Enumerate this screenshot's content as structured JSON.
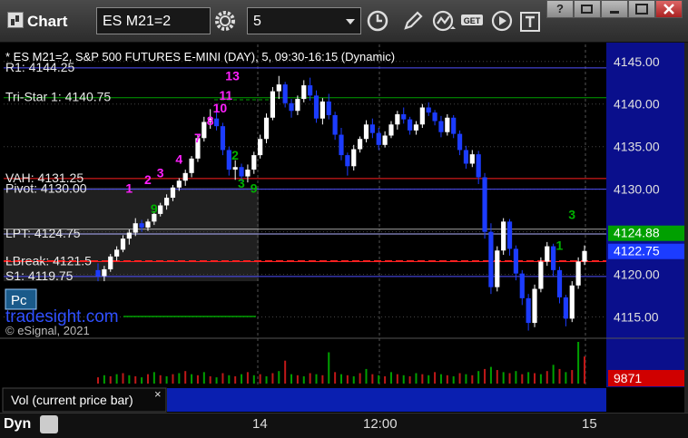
{
  "toolbar": {
    "app_title": "Chart",
    "symbol": "ES M21=2",
    "interval": "5",
    "get_label": "GET"
  },
  "window_buttons": [
    "?",
    "",
    "",
    ""
  ],
  "footer": {
    "dyn_label": "Dyn",
    "x_ticks": [
      "14",
      "12:00",
      "15"
    ]
  },
  "chart_data": {
    "type": "candlestick",
    "title": "* ES M21=2, S&P 500 FUTURES E-MINI (DAY), 5, 09:30-16:15 (Dynamic)",
    "ylim": [
      4112.5,
      4147.0
    ],
    "y_ticks": [
      "4145.00",
      "4140.00",
      "4135.00",
      "4130.00",
      "4125.00",
      "4120.00",
      "4115.00"
    ],
    "price_badges": [
      {
        "label": "4124.88",
        "value": 4124.88,
        "color": "#00a000"
      },
      {
        "label": "4122.75",
        "value": 4122.75,
        "color": "#1c3cff"
      }
    ],
    "levels": [
      {
        "label": "R1: 4144.25",
        "value": 4144.25,
        "color": "#5050ff"
      },
      {
        "label": "Tri-Star 1: 4140.75",
        "value": 4140.75,
        "color": "#00a000"
      },
      {
        "label": "VAH: 4131.25",
        "value": 4131.25,
        "color": "#ff2020"
      },
      {
        "label": "Pivot: 4130.00",
        "value": 4130.0,
        "color": "#5050ff"
      },
      {
        "label": "LPT: 4124.75",
        "value": 4124.75,
        "color": "#b0b0ff"
      },
      {
        "label": "LBreak: 4121.5",
        "value": 4121.5,
        "color": "#ff2020"
      },
      {
        "label": "S1: 4119.75",
        "value": 4119.75,
        "color": "#5050ff"
      }
    ],
    "extra_lines": [
      4140.5,
      4131.4,
      4121.6,
      4120.7,
      4125.3
    ],
    "candles": [
      [
        4120.5,
        4121.3,
        4119.2,
        4119.8
      ],
      [
        4119.8,
        4121.0,
        4119.2,
        4120.6
      ],
      [
        4120.6,
        4122.4,
        4120.3,
        4122.1
      ],
      [
        4122.1,
        4123.3,
        4121.6,
        4122.9
      ],
      [
        4122.9,
        4124.6,
        4122.6,
        4124.2
      ],
      [
        4124.2,
        4125.3,
        4123.5,
        4124.9
      ],
      [
        4124.9,
        4126.6,
        4124.5,
        4126.0
      ],
      [
        4126.0,
        4126.4,
        4125.0,
        4125.5
      ],
      [
        4125.5,
        4126.5,
        4125.1,
        4126.2
      ],
      [
        4126.2,
        4127.4,
        4125.8,
        4127.1
      ],
      [
        4127.1,
        4128.4,
        4126.8,
        4128.1
      ],
      [
        4128.1,
        4129.4,
        4127.6,
        4129.0
      ],
      [
        4129.0,
        4130.5,
        4128.6,
        4130.2
      ],
      [
        4130.2,
        4131.3,
        4129.8,
        4131.0
      ],
      [
        4131.0,
        4132.3,
        4130.4,
        4131.9
      ],
      [
        4131.9,
        4133.9,
        4131.4,
        4133.6
      ],
      [
        4133.6,
        4136.5,
        4133.2,
        4136.0
      ],
      [
        4136.0,
        4138.5,
        4135.6,
        4137.9
      ],
      [
        4137.9,
        4139.4,
        4137.1,
        4138.3
      ],
      [
        4138.3,
        4139.1,
        4136.9,
        4137.4
      ],
      [
        4137.4,
        4137.8,
        4134.0,
        4134.6
      ],
      [
        4134.6,
        4135.0,
        4131.6,
        4132.3
      ],
      [
        4132.3,
        4133.4,
        4131.1,
        4132.6
      ],
      [
        4132.6,
        4133.0,
        4130.9,
        4131.5
      ],
      [
        4131.5,
        4132.9,
        4130.8,
        4132.3
      ],
      [
        4132.3,
        4134.4,
        4131.8,
        4134.0
      ],
      [
        4134.0,
        4136.4,
        4133.6,
        4135.9
      ],
      [
        4135.9,
        4138.9,
        4135.4,
        4138.4
      ],
      [
        4138.4,
        4142.0,
        4138.1,
        4141.5
      ],
      [
        4141.5,
        4143.3,
        4140.6,
        4142.3
      ],
      [
        4142.3,
        4142.6,
        4139.6,
        4140.1
      ],
      [
        4140.1,
        4140.6,
        4138.4,
        4139.2
      ],
      [
        4139.2,
        4141.0,
        4138.7,
        4140.6
      ],
      [
        4140.6,
        4142.8,
        4140.2,
        4142.2
      ],
      [
        4142.2,
        4143.1,
        4140.4,
        4141.0
      ],
      [
        4141.0,
        4141.6,
        4137.8,
        4138.3
      ],
      [
        4138.3,
        4140.7,
        4137.6,
        4140.3
      ],
      [
        4140.3,
        4141.2,
        4138.2,
        4138.7
      ],
      [
        4138.7,
        4139.1,
        4135.8,
        4136.4
      ],
      [
        4136.4,
        4137.2,
        4133.4,
        4134.0
      ],
      [
        4134.0,
        4134.3,
        4131.6,
        4132.7
      ],
      [
        4132.7,
        4135.2,
        4132.2,
        4134.7
      ],
      [
        4134.7,
        4136.2,
        4134.3,
        4135.9
      ],
      [
        4135.9,
        4138.1,
        4135.5,
        4137.6
      ],
      [
        4137.6,
        4138.3,
        4136.0,
        4136.6
      ],
      [
        4136.6,
        4137.2,
        4134.6,
        4135.2
      ],
      [
        4135.2,
        4136.8,
        4134.9,
        4136.3
      ],
      [
        4136.3,
        4138.0,
        4136.0,
        4137.6
      ],
      [
        4137.6,
        4139.2,
        4137.0,
        4138.8
      ],
      [
        4138.8,
        4139.6,
        4137.7,
        4138.2
      ],
      [
        4138.2,
        4138.5,
        4136.4,
        4136.9
      ],
      [
        4136.9,
        4138.0,
        4136.4,
        4137.6
      ],
      [
        4137.6,
        4140.0,
        4137.2,
        4139.6
      ],
      [
        4139.6,
        4140.2,
        4138.6,
        4139.0
      ],
      [
        4139.0,
        4139.3,
        4137.5,
        4138.0
      ],
      [
        4138.0,
        4138.6,
        4136.1,
        4136.7
      ],
      [
        4136.7,
        4138.8,
        4136.3,
        4138.4
      ],
      [
        4138.4,
        4138.7,
        4136.0,
        4136.5
      ],
      [
        4136.5,
        4136.9,
        4134.0,
        4134.6
      ],
      [
        4134.6,
        4135.1,
        4132.4,
        4133.0
      ],
      [
        4133.0,
        4134.6,
        4132.6,
        4134.1
      ],
      [
        4134.1,
        4134.5,
        4130.6,
        4131.4
      ],
      [
        4131.4,
        4131.9,
        4124.2,
        4125.0
      ],
      [
        4125.0,
        4126.0,
        4117.7,
        4118.5
      ],
      [
        4118.5,
        4123.3,
        4118.0,
        4122.8
      ],
      [
        4122.8,
        4126.6,
        4122.3,
        4126.2
      ],
      [
        4126.2,
        4126.5,
        4122.2,
        4123.0
      ],
      [
        4123.0,
        4123.4,
        4119.3,
        4120.1
      ],
      [
        4120.1,
        4120.5,
        4116.4,
        4117.2
      ],
      [
        4117.2,
        4117.7,
        4113.4,
        4114.3
      ],
      [
        4114.3,
        4118.8,
        4113.8,
        4118.3
      ],
      [
        4118.3,
        4122.0,
        4117.9,
        4121.5
      ],
      [
        4121.5,
        4123.8,
        4121.0,
        4123.3
      ],
      [
        4123.3,
        4123.6,
        4119.8,
        4120.5
      ],
      [
        4120.5,
        4120.9,
        4116.6,
        4117.3
      ],
      [
        4117.3,
        4117.6,
        4113.9,
        4114.8
      ],
      [
        4114.8,
        4119.2,
        4114.4,
        4118.7
      ],
      [
        4118.7,
        4122.0,
        4118.3,
        4121.5
      ],
      [
        4121.5,
        4123.4,
        4121.1,
        4122.75
      ]
    ],
    "counts": [
      {
        "label": "1",
        "color": "#ff20ff",
        "idx": 5,
        "value": 4129.6
      },
      {
        "label": "2",
        "color": "#ff20ff",
        "idx": 8,
        "value": 4130.6
      },
      {
        "label": "3",
        "color": "#ff20ff",
        "idx": 10,
        "value": 4131.4
      },
      {
        "label": "4",
        "color": "#ff20ff",
        "idx": 13,
        "value": 4133.0
      },
      {
        "label": "7",
        "color": "#ff20ff",
        "idx": 16,
        "value": 4135.5
      },
      {
        "label": "8",
        "color": "#ff20ff",
        "idx": 18,
        "value": 4137.5
      },
      {
        "label": "10",
        "color": "#ff20ff",
        "idx": 19,
        "value": 4139.0
      },
      {
        "label": "11",
        "color": "#ff20ff",
        "idx": 20,
        "value": 4140.5
      },
      {
        "label": "13",
        "color": "#ff20ff",
        "idx": 21,
        "value": 4142.8
      },
      {
        "label": "2",
        "color": "#00b000",
        "idx": 22,
        "value": 4133.5
      },
      {
        "label": "3",
        "color": "#00b000",
        "idx": 23,
        "value": 4130.2
      },
      {
        "label": "9",
        "color": "#00b000",
        "idx": 25,
        "value": 4129.6
      },
      {
        "label": "9",
        "color": "#00b000",
        "idx": 9,
        "value": 4127.2
      },
      {
        "label": "1",
        "color": "#00b000",
        "idx": 74,
        "value": 4122.9
      },
      {
        "label": "3",
        "color": "#00b000",
        "idx": 76,
        "value": 4126.5
      }
    ],
    "volume_value": "9871",
    "volume": [
      6,
      8,
      7,
      9,
      10,
      8,
      7,
      6,
      9,
      11,
      8,
      7,
      9,
      10,
      12,
      9,
      8,
      11,
      7,
      6,
      10,
      8,
      7,
      9,
      11,
      8,
      9,
      7,
      10,
      12,
      22,
      9,
      8,
      7,
      10,
      9,
      8,
      30,
      11,
      9,
      8,
      7,
      10,
      14,
      9,
      8,
      7,
      11,
      9,
      8,
      7,
      10,
      9,
      8,
      11,
      9,
      8,
      7,
      10,
      9,
      8,
      12,
      14,
      16,
      13,
      11,
      10,
      12,
      9,
      11,
      10,
      9,
      12,
      18,
      14,
      11,
      13,
      40,
      26
    ],
    "legend": "Vol (current price bar)",
    "watermark": "tradesight.com",
    "copyright": "© eSignal, 2021",
    "pc_label": "Pc"
  }
}
